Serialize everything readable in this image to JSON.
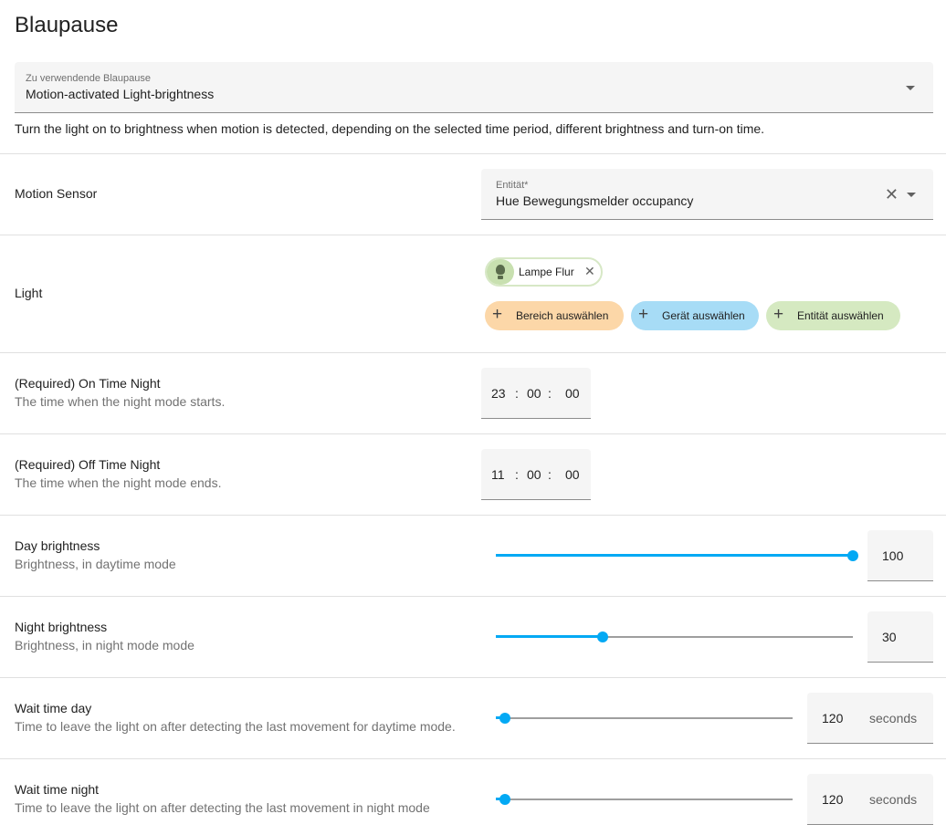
{
  "page": {
    "title": "Blaupause"
  },
  "blueprint": {
    "label": "Zu verwendende Blaupause",
    "value": "Motion-activated Light-brightness",
    "description": "Turn the light on to brightness when motion is detected, depending on the selected time period, different brightness and turn-on time."
  },
  "motion_sensor": {
    "title": "Motion Sensor",
    "field_label": "Entität*",
    "value": "Hue Bewegungsmelder occupancy",
    "clear_glyph": "✕"
  },
  "light": {
    "title": "Light",
    "chip_label": "Lampe Flur",
    "chip_remove_glyph": "✕",
    "add_area": "Bereich auswählen",
    "add_device": "Gerät auswählen",
    "add_entity": "Entität auswählen",
    "plus_glyph": "+",
    "colors": {
      "area": "#fcd7a8",
      "device": "#a7dcf6",
      "entity": "#d5e9c1"
    }
  },
  "on_time_night": {
    "title": "(Required) On Time Night",
    "subtitle": "The time when the night mode starts.",
    "hours": "23",
    "minutes": "00",
    "seconds": "00",
    "sep": ":"
  },
  "off_time_night": {
    "title": "(Required) Off Time Night",
    "subtitle": "The time when the night mode ends.",
    "hours": "11",
    "minutes": "00",
    "seconds": "00",
    "sep": ":"
  },
  "day_brightness": {
    "title": "Day brightness",
    "subtitle": "Brightness, in daytime mode",
    "value": "100",
    "min": 0,
    "max": 100
  },
  "night_brightness": {
    "title": "Night brightness",
    "subtitle": "Brightness, in night mode mode",
    "value": "30",
    "min": 0,
    "max": 100
  },
  "wait_time_day": {
    "title": "Wait time day",
    "subtitle": "Time to leave the light on after detecting the last movement for daytime mode.",
    "value": "120",
    "unit": "seconds",
    "fraction": 0.03
  },
  "wait_time_night": {
    "title": "Wait time night",
    "subtitle": "Time to leave the light on after detecting the last movement in night mode",
    "value": "120",
    "unit": "seconds",
    "fraction": 0.03
  },
  "colors": {
    "accent": "#03a9f4",
    "field_bg": "#f5f5f5"
  },
  "icons": {
    "dropdown": "menu-down-icon",
    "clear": "close-icon",
    "bulb": "lightbulb-icon",
    "plus": "plus-icon"
  }
}
